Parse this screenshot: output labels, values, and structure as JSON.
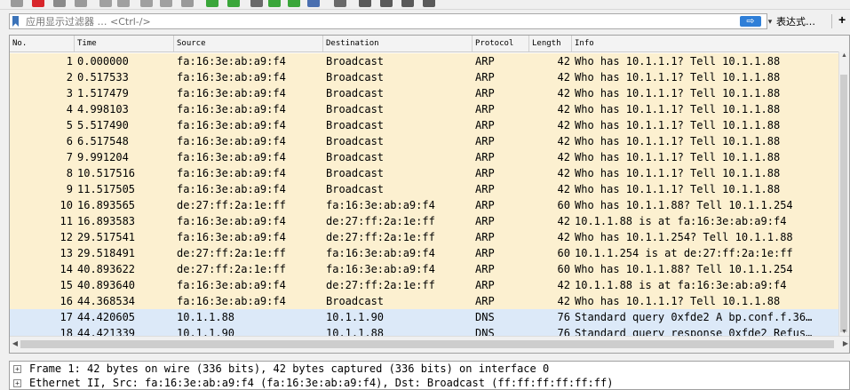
{
  "colors": {
    "arp_row": "#fcf0d0",
    "dns_row": "#dce9f8",
    "selected_row": "#fcf0d0"
  },
  "toolbar": {
    "icons": [
      "shark-fin-icon",
      "stop-icon",
      "restart-icon",
      "options-icon",
      "open-icon",
      "save-icon",
      "close-file-icon",
      "reload-icon",
      "find-icon",
      "back-icon",
      "forward-icon",
      "goto-icon",
      "first-icon",
      "last-icon",
      "autoscroll-icon",
      "colorize-icon",
      "zoom-in-icon",
      "zoom-out-icon",
      "zoom-normal-icon",
      "resize-columns-icon"
    ]
  },
  "filter": {
    "placeholder": "应用显示过滤器 … <Ctrl-/>",
    "apply_glyph": "⇨",
    "dropdown_glyph": "▾",
    "expression_label": "表达式…",
    "add_glyph": "+"
  },
  "columns": [
    "No.",
    "Time",
    "Source",
    "Destination",
    "Protocol",
    "Length",
    "Info"
  ],
  "packets": [
    {
      "no": "1",
      "time": "0.000000",
      "src": "fa:16:3e:ab:a9:f4",
      "dst": "Broadcast",
      "proto": "ARP",
      "len": "42",
      "info": "Who has 10.1.1.1? Tell 10.1.1.88",
      "kind": "arp"
    },
    {
      "no": "2",
      "time": "0.517533",
      "src": "fa:16:3e:ab:a9:f4",
      "dst": "Broadcast",
      "proto": "ARP",
      "len": "42",
      "info": "Who has 10.1.1.1? Tell 10.1.1.88",
      "kind": "arp"
    },
    {
      "no": "3",
      "time": "1.517479",
      "src": "fa:16:3e:ab:a9:f4",
      "dst": "Broadcast",
      "proto": "ARP",
      "len": "42",
      "info": "Who has 10.1.1.1? Tell 10.1.1.88",
      "kind": "arp"
    },
    {
      "no": "4",
      "time": "4.998103",
      "src": "fa:16:3e:ab:a9:f4",
      "dst": "Broadcast",
      "proto": "ARP",
      "len": "42",
      "info": "Who has 10.1.1.1? Tell 10.1.1.88",
      "kind": "arp"
    },
    {
      "no": "5",
      "time": "5.517490",
      "src": "fa:16:3e:ab:a9:f4",
      "dst": "Broadcast",
      "proto": "ARP",
      "len": "42",
      "info": "Who has 10.1.1.1? Tell 10.1.1.88",
      "kind": "arp"
    },
    {
      "no": "6",
      "time": "6.517548",
      "src": "fa:16:3e:ab:a9:f4",
      "dst": "Broadcast",
      "proto": "ARP",
      "len": "42",
      "info": "Who has 10.1.1.1? Tell 10.1.1.88",
      "kind": "arp"
    },
    {
      "no": "7",
      "time": "9.991204",
      "src": "fa:16:3e:ab:a9:f4",
      "dst": "Broadcast",
      "proto": "ARP",
      "len": "42",
      "info": "Who has 10.1.1.1? Tell 10.1.1.88",
      "kind": "arp"
    },
    {
      "no": "8",
      "time": "10.517516",
      "src": "fa:16:3e:ab:a9:f4",
      "dst": "Broadcast",
      "proto": "ARP",
      "len": "42",
      "info": "Who has 10.1.1.1? Tell 10.1.1.88",
      "kind": "arp"
    },
    {
      "no": "9",
      "time": "11.517505",
      "src": "fa:16:3e:ab:a9:f4",
      "dst": "Broadcast",
      "proto": "ARP",
      "len": "42",
      "info": "Who has 10.1.1.1? Tell 10.1.1.88",
      "kind": "arp"
    },
    {
      "no": "10",
      "time": "16.893565",
      "src": "de:27:ff:2a:1e:ff",
      "dst": "fa:16:3e:ab:a9:f4",
      "proto": "ARP",
      "len": "60",
      "info": "Who has 10.1.1.88? Tell 10.1.1.254",
      "kind": "arp"
    },
    {
      "no": "11",
      "time": "16.893583",
      "src": "fa:16:3e:ab:a9:f4",
      "dst": "de:27:ff:2a:1e:ff",
      "proto": "ARP",
      "len": "42",
      "info": "10.1.1.88 is at fa:16:3e:ab:a9:f4",
      "kind": "arp"
    },
    {
      "no": "12",
      "time": "29.517541",
      "src": "fa:16:3e:ab:a9:f4",
      "dst": "de:27:ff:2a:1e:ff",
      "proto": "ARP",
      "len": "42",
      "info": "Who has 10.1.1.254? Tell 10.1.1.88",
      "kind": "arp"
    },
    {
      "no": "13",
      "time": "29.518491",
      "src": "de:27:ff:2a:1e:ff",
      "dst": "fa:16:3e:ab:a9:f4",
      "proto": "ARP",
      "len": "60",
      "info": "10.1.1.254 is at de:27:ff:2a:1e:ff",
      "kind": "arp"
    },
    {
      "no": "14",
      "time": "40.893622",
      "src": "de:27:ff:2a:1e:ff",
      "dst": "fa:16:3e:ab:a9:f4",
      "proto": "ARP",
      "len": "60",
      "info": "Who has 10.1.1.88? Tell 10.1.1.254",
      "kind": "arp"
    },
    {
      "no": "15",
      "time": "40.893640",
      "src": "fa:16:3e:ab:a9:f4",
      "dst": "de:27:ff:2a:1e:ff",
      "proto": "ARP",
      "len": "42",
      "info": "10.1.1.88 is at fa:16:3e:ab:a9:f4",
      "kind": "arp"
    },
    {
      "no": "16",
      "time": "44.368534",
      "src": "fa:16:3e:ab:a9:f4",
      "dst": "Broadcast",
      "proto": "ARP",
      "len": "42",
      "info": "Who has 10.1.1.1? Tell 10.1.1.88",
      "kind": "arp"
    },
    {
      "no": "17",
      "time": "44.420605",
      "src": "10.1.1.88",
      "dst": "10.1.1.90",
      "proto": "DNS",
      "len": "76",
      "info": "Standard query 0xfde2 A bp.conf.f.36…",
      "kind": "dns"
    },
    {
      "no": "18",
      "time": "44.421339",
      "src": "10.1.1.90",
      "dst": "10.1.1.88",
      "proto": "DNS",
      "len": "76",
      "info": "Standard query response 0xfde2 Refus…",
      "kind": "dns"
    }
  ],
  "details": [
    {
      "expander": "+",
      "text": "Frame 1: 42 bytes on wire (336 bits), 42 bytes captured (336 bits) on interface 0"
    },
    {
      "expander": "+",
      "text": "Ethernet II, Src: fa:16:3e:ab:a9:f4 (fa:16:3e:ab:a9:f4), Dst: Broadcast (ff:ff:ff:ff:ff:ff)"
    }
  ],
  "scroll": {
    "up": "▲",
    "down": "▼",
    "left": "◀",
    "right": "▶"
  }
}
